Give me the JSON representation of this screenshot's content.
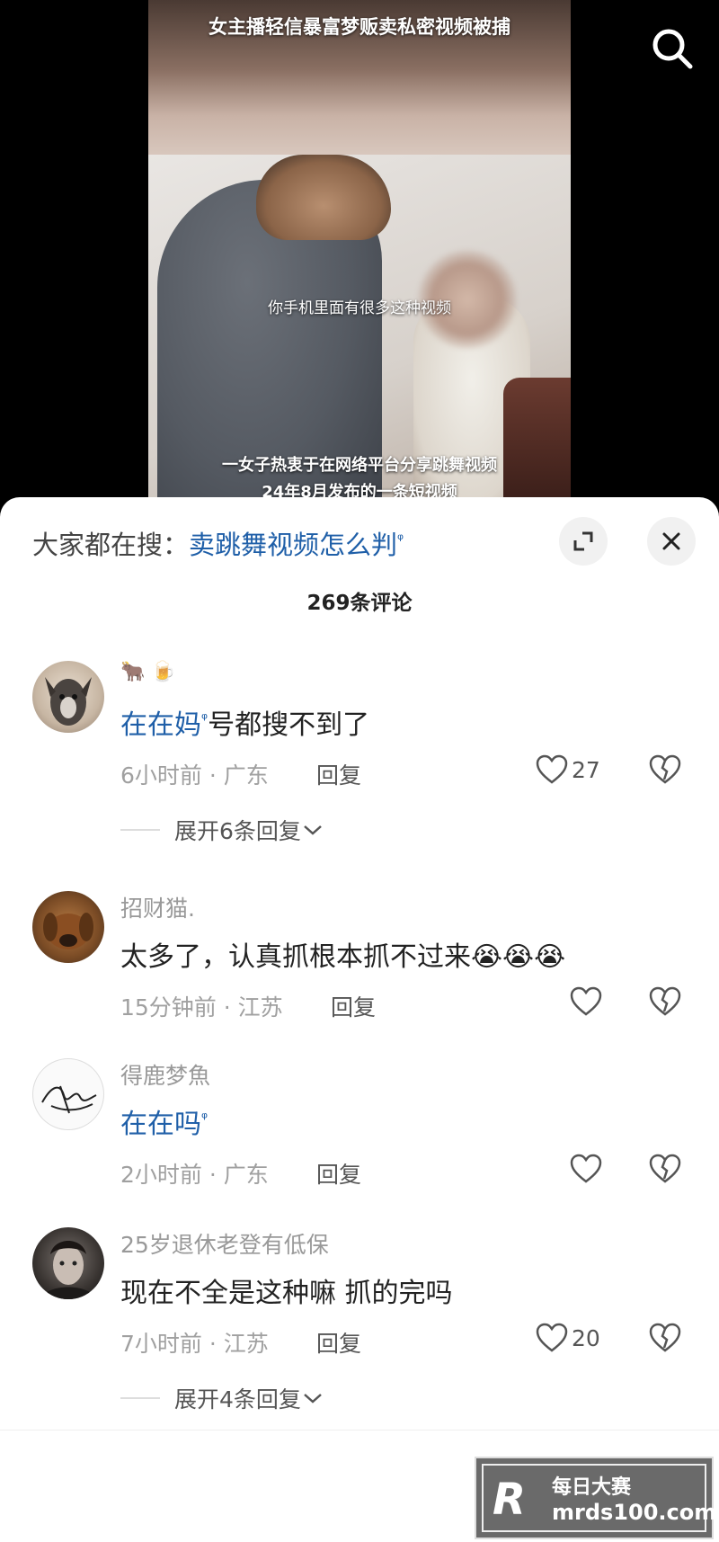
{
  "video": {
    "top_caption": "女主播轻信暴富梦贩卖私密视频被捕",
    "subtitle_dialog": "你手机里面有很多这种视频",
    "subtitle_line1": "一女子热衷于在网络平台分享跳舞视频",
    "subtitle_line2": "24年8月发布的一条短视频"
  },
  "sheet": {
    "search_prefix": "大家都在搜：",
    "search_keyword": "卖跳舞视频怎么判",
    "comment_count": "269条评论"
  },
  "comments": [
    {
      "author": "",
      "badges": "🐂 🍺",
      "text_link": "在在妈",
      "text_rest": "号都搜不到了",
      "meta": "6小时前 · 广东",
      "reply": "回复",
      "likes": "27",
      "expand": "展开6条回复"
    },
    {
      "author": "招财猫.",
      "text_rest": "太多了，认真抓根本抓不过来😭😭😭",
      "meta": "15分钟前 · 江苏",
      "reply": "回复",
      "likes": ""
    },
    {
      "author": "得鹿梦魚",
      "text_link": "在在吗",
      "meta": "2小时前 · 广东",
      "reply": "回复",
      "likes": ""
    },
    {
      "author": "25岁退休老登有低保",
      "text_rest": "现在不全是这种嘛  抓的完吗",
      "meta": "7小时前 · 江苏",
      "reply": "回复",
      "likes": "20",
      "expand": "展开4条回复"
    }
  ],
  "watermark": {
    "logo": "R",
    "name": "每日大赛",
    "url": "mrds100.com"
  },
  "colors": {
    "link": "#1f5fa8",
    "meta": "#a0a0a0"
  }
}
